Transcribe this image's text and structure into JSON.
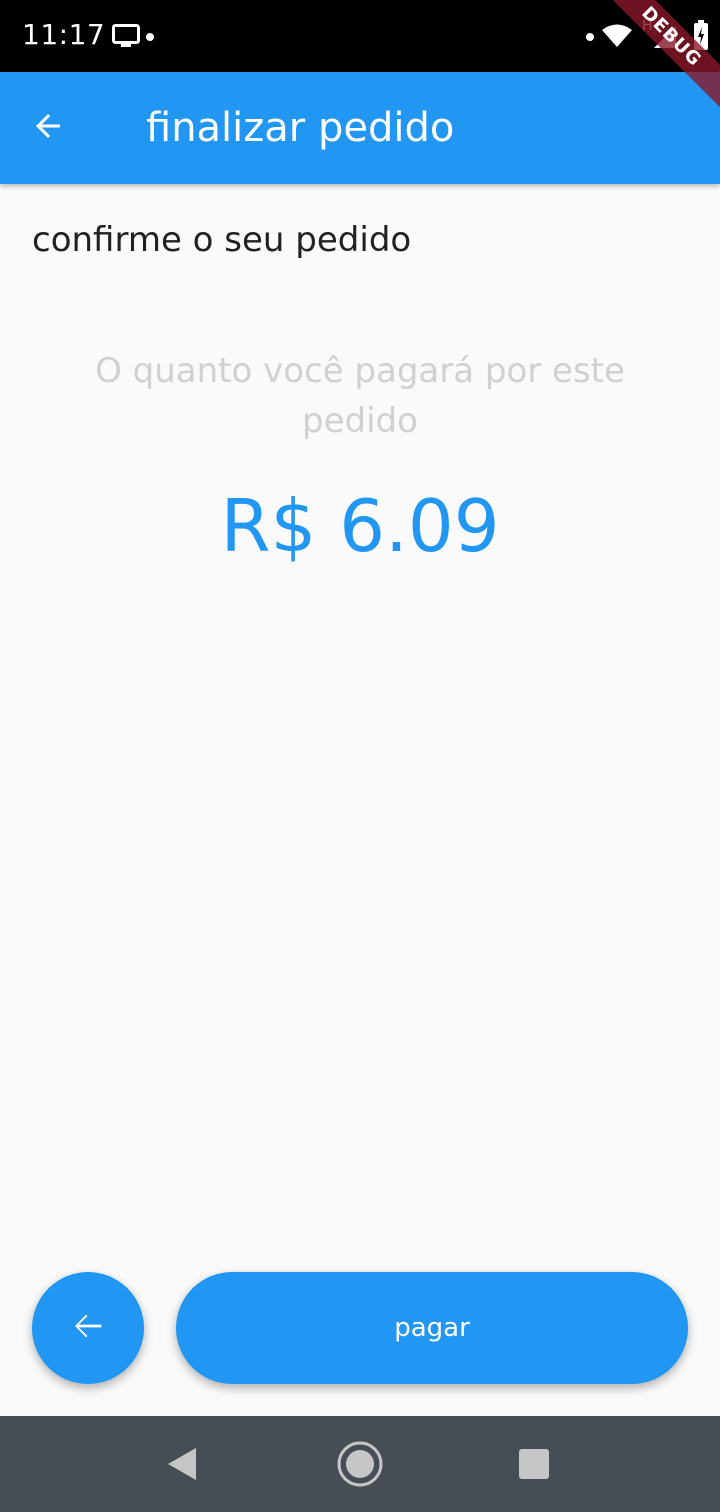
{
  "status_bar": {
    "time": "11:17",
    "icons": [
      "cast-icon",
      "notification-dot-icon",
      "wifi-icon",
      "signal-icon",
      "battery-charging-icon"
    ],
    "network_label": "H"
  },
  "debug_banner": {
    "label": "DEBUG"
  },
  "app_bar": {
    "title": "finalizar pedido",
    "back_icon": "arrow-back-icon",
    "color": "#2196f3"
  },
  "main": {
    "subtitle": "confirme o seu pedido",
    "hint": "O quanto você pagará por este pedido",
    "amount": "R$ 6.09",
    "amount_color": "#2196f3"
  },
  "actions": {
    "back_icon": "arrow-back-icon",
    "pay_label": "pagar"
  },
  "nav_bar": {
    "icons": [
      "back-triangle-icon",
      "home-circle-icon",
      "recents-square-icon"
    ]
  }
}
